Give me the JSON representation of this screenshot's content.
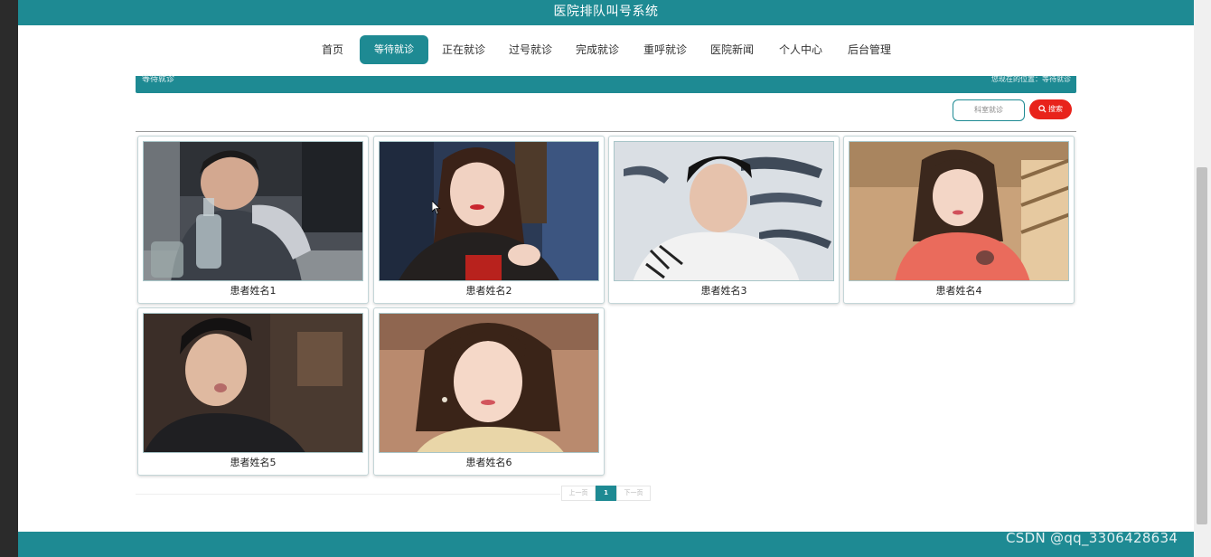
{
  "header": {
    "title": "医院排队叫号系统"
  },
  "nav": {
    "items": [
      {
        "label": "首页",
        "active": false
      },
      {
        "label": "等待就诊",
        "active": true
      },
      {
        "label": "正在就诊",
        "active": false
      },
      {
        "label": "过号就诊",
        "active": false
      },
      {
        "label": "完成就诊",
        "active": false
      },
      {
        "label": "重呼就诊",
        "active": false
      },
      {
        "label": "医院新闻",
        "active": false
      },
      {
        "label": "个人中心",
        "active": false
      },
      {
        "label": "后台管理",
        "active": false
      }
    ]
  },
  "breadcrumb": {
    "title": "等待就诊",
    "location": "您现在的位置：等待就诊"
  },
  "search": {
    "placeholder": "科室就诊",
    "button_label": "搜索",
    "button_icon": "search-icon"
  },
  "cards": [
    {
      "name": "患者姓名1"
    },
    {
      "name": "患者姓名2"
    },
    {
      "name": "患者姓名3"
    },
    {
      "name": "患者姓名4"
    },
    {
      "name": "患者姓名5"
    },
    {
      "name": "患者姓名6"
    }
  ],
  "pagination": {
    "prev_label": "上一页",
    "current_page": "1",
    "next_label": "下一页"
  },
  "watermark": "CSDN @qq_3306428634",
  "colors": {
    "primary": "#1e8a93",
    "search_button": "#e8231b",
    "background": "#ffffff"
  }
}
